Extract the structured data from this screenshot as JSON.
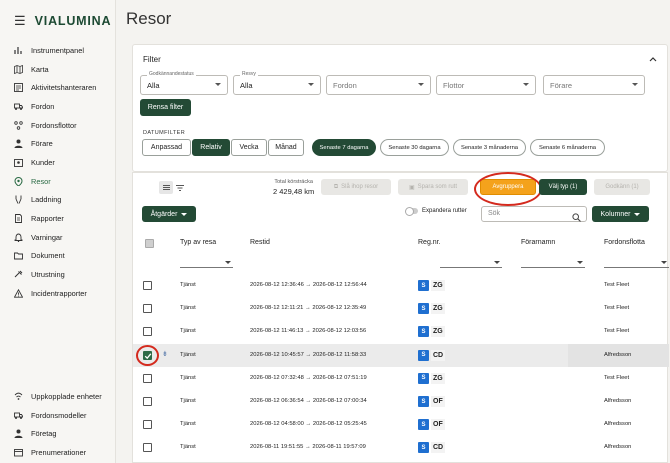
{
  "app": {
    "brand": "VIALUMINA"
  },
  "sidebar": {
    "items": [
      {
        "label": "Instrumentpanel",
        "icon": "bar-chart-icon"
      },
      {
        "label": "Karta",
        "icon": "map-icon"
      },
      {
        "label": "Aktivitetshanteraren",
        "icon": "activity-list-icon"
      },
      {
        "label": "Fordon",
        "icon": "truck-icon"
      },
      {
        "label": "Fordonsflottor",
        "icon": "fleet-icon"
      },
      {
        "label": "Förare",
        "icon": "person-icon"
      },
      {
        "label": "Kunder",
        "icon": "customers-icon"
      },
      {
        "label": "Resor",
        "icon": "route-pin-icon",
        "active": true
      },
      {
        "label": "Laddning",
        "icon": "charging-icon"
      },
      {
        "label": "Rapporter",
        "icon": "reports-icon"
      },
      {
        "label": "Varningar",
        "icon": "bell-icon"
      },
      {
        "label": "Dokument",
        "icon": "folder-icon"
      },
      {
        "label": "Utrustning",
        "icon": "equipment-icon"
      },
      {
        "label": "Incidentrapporter",
        "icon": "warning-icon"
      }
    ],
    "bottom_items": [
      {
        "label": "Uppkopplade enheter",
        "icon": "connected-devices-icon"
      },
      {
        "label": "Fordonsmodeller",
        "icon": "truck-model-icon"
      },
      {
        "label": "Företag",
        "icon": "company-icon"
      },
      {
        "label": "Prenumerationer",
        "icon": "subscription-icon"
      }
    ]
  },
  "page": {
    "title": "Resor"
  },
  "filter": {
    "title": "Filter",
    "status": {
      "label": "Godkännandestatus",
      "value": "Alla"
    },
    "resvy": {
      "label": "Resvy",
      "value": "Alla"
    },
    "fordon": {
      "placeholder": "Fordon"
    },
    "flottor": {
      "placeholder": "Flottor"
    },
    "forare": {
      "placeholder": "Förare"
    },
    "clear_label": "Rensa filter",
    "datum_label": "DATUMFILTER",
    "date_buttons": [
      "Anpassad",
      "Relativ",
      "Vecka",
      "Månad"
    ],
    "date_active": "Relativ",
    "relative_pills": [
      "Senaste 7 dagarna",
      "Senaste 30 dagarna",
      "Senaste 3 månaderna",
      "Senaste 6 månaderna"
    ],
    "relative_active": "Senaste 7 dagarna"
  },
  "toolbar": {
    "total_label": "Total körsträcka",
    "total_value": "2 429,48 km",
    "slå_ihop": "Slå ihop resor",
    "spara": "Spara som rutt",
    "avgruppera": "Avgruppera",
    "valj_typ": "Välj typ (1)",
    "godkann": "Godkänn (1)",
    "atgarder": "Åtgärder",
    "expandera": "Expandera rutter",
    "search_placeholder": "Sök",
    "kolumner": "Kolumner",
    "accent": "#f4a21c",
    "brand_green": "#234a35"
  },
  "table": {
    "columns": [
      "Typ av resa",
      "Restid",
      "Reg.nr.",
      "Förarnamn",
      "Fordonsflotta"
    ],
    "rows": [
      {
        "type": "Tjänst",
        "time": "2026-08-12 12:36:46 → 2026-08-12 12:56:44",
        "reg": "ZG",
        "driver": "",
        "fleet": "Test Fleet",
        "checked": false
      },
      {
        "type": "Tjänst",
        "time": "2026-08-12 12:11:21 → 2026-08-12 12:35:49",
        "reg": "ZG",
        "driver": "",
        "fleet": "Test Fleet",
        "checked": false
      },
      {
        "type": "Tjänst",
        "time": "2026-08-12 11:46:13 → 2026-08-12 12:03:56",
        "reg": "ZG",
        "driver": "",
        "fleet": "Test Fleet",
        "checked": false
      },
      {
        "type": "Tjänst",
        "time": "2026-08-12 10:45:57 → 2026-08-12 11:58:33",
        "reg": "CD",
        "driver": "",
        "fleet": "Alfredsson",
        "checked": true
      },
      {
        "type": "Tjänst",
        "time": "2026-08-12 07:32:48 → 2026-08-12 07:51:19",
        "reg": "ZG",
        "driver": "",
        "fleet": "Test Fleet",
        "checked": false
      },
      {
        "type": "Tjänst",
        "time": "2026-08-12 06:36:54 → 2026-08-12 07:00:34",
        "reg": "OF",
        "driver": "",
        "fleet": "Alfredsson",
        "checked": false
      },
      {
        "type": "Tjänst",
        "time": "2026-08-12 04:58:00 → 2026-08-12 05:25:45",
        "reg": "OF",
        "driver": "",
        "fleet": "Alfredsson",
        "checked": false
      },
      {
        "type": "Tjänst",
        "time": "2026-08-11 19:51:55 → 2026-08-11 19:57:09",
        "reg": "CD",
        "driver": "",
        "fleet": "Alfredsson",
        "checked": false
      }
    ],
    "plate_country": "S"
  }
}
